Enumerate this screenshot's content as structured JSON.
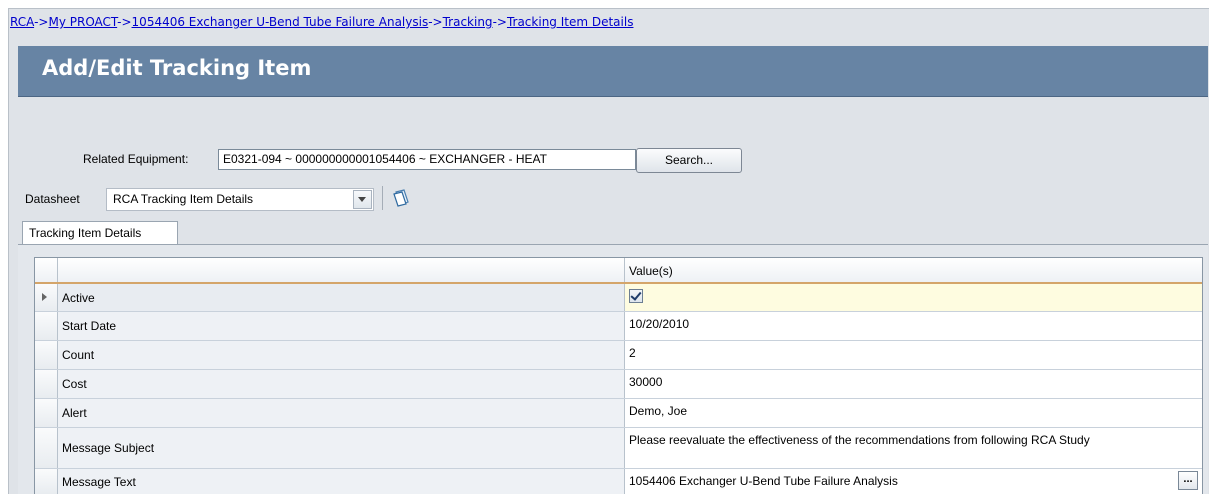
{
  "breadcrumb": {
    "items": [
      "RCA",
      "My PROACT",
      "1054406 Exchanger U-Bend Tube Failure Analysis",
      "Tracking",
      "Tracking Item Details"
    ],
    "separator": "->"
  },
  "header": {
    "title": "Add/Edit Tracking Item"
  },
  "related_equipment": {
    "label": "Related Equipment:",
    "value": "E0321-094 ~ 000000000001054406 ~ EXCHANGER - HEAT",
    "search_label": "Search..."
  },
  "datasheet": {
    "label": "Datasheet",
    "selected": "RCA Tracking Item Details"
  },
  "tabs": [
    {
      "label": "Tracking Item Details"
    }
  ],
  "grid": {
    "value_header": "Value(s)",
    "rows": [
      {
        "name": "Active",
        "value": "",
        "checked": true
      },
      {
        "name": "Start Date",
        "value": "10/20/2010"
      },
      {
        "name": "Count",
        "value": "2"
      },
      {
        "name": "Cost",
        "value": "30000"
      },
      {
        "name": "Alert",
        "value": "Demo, Joe"
      },
      {
        "name": "Message Subject",
        "value": "Please reevaluate the effectiveness of the recommendations from following RCA Study"
      },
      {
        "name": "Message Text",
        "value": "1054406 Exchanger U-Bend Tube Failure Analysis",
        "button": "..."
      }
    ]
  },
  "colors": {
    "header_bg": "#6784a4",
    "link": "#0000cc",
    "active_row": "#fefce0"
  }
}
